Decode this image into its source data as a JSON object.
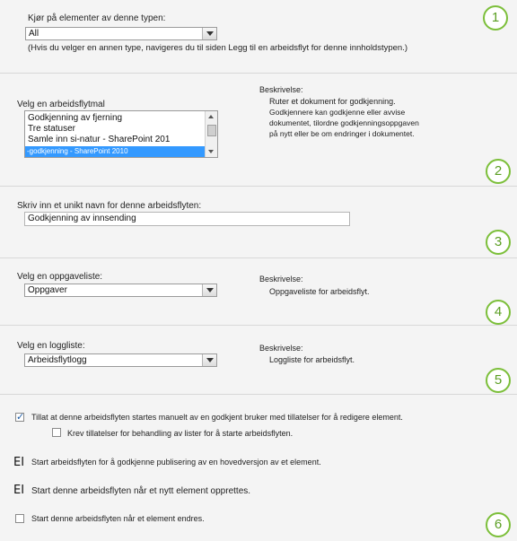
{
  "section1": {
    "number": "1",
    "type_label": "Kjør på elementer av denne typen:",
    "type_value": "All",
    "hint": "(Hvis du velger en annen type, navigeres du til siden Legg til en arbeidsflyt for denne innholdstypen.)"
  },
  "section2": {
    "number": "2",
    "template_label": "Velg en arbeidsflytmal",
    "templates": [
      "Godkjenning av fjerning",
      "Tre statuser",
      "Samle inn si-natur - SharePoint 201",
      "-godkjenning - SharePoint 2010"
    ],
    "description_label": "Beskrivelse:",
    "description_lines": [
      "Ruter et dokument for godkjenning.",
      "Godkjennere kan godkjenne eller avvise",
      "dokumentet, tilordne godkjenningsoppgaven",
      "på nytt eller be om endringer i dokumentet."
    ]
  },
  "section3": {
    "number": "3",
    "name_label": "Skriv inn et unikt navn for denne arbeidsflyten:",
    "name_value": "Godkjenning av innsending"
  },
  "section4": {
    "number": "4",
    "task_label": "Velg en oppgaveliste:",
    "task_value": "Oppgaver",
    "description_label": "Beskrivelse:",
    "description": "Oppgaveliste for arbeidsflyt."
  },
  "section5": {
    "number": "5",
    "history_label": "Velg en loggliste:",
    "history_value": "Arbeidsflytlogg",
    "description_label": "Beskrivelse:",
    "description": "Loggliste for arbeidsflyt."
  },
  "section6": {
    "number": "6",
    "options": {
      "manual": "Tillat at denne arbeidsflyten startes manuelt av en godkjent bruker med tillatelser for å redigere element.",
      "require_manage": "Krev tillatelser for behandling av lister for å starte arbeidsflyten.",
      "publish_marker": "EI",
      "publish": "Start arbeidsflyten for å godkjenne publisering av en hovedversjon av et element.",
      "create_marker": "EI",
      "create": "Start denne arbeidsflyten når et nytt element opprettes.",
      "change": "Start denne arbeidsflyten når et element endres."
    }
  }
}
